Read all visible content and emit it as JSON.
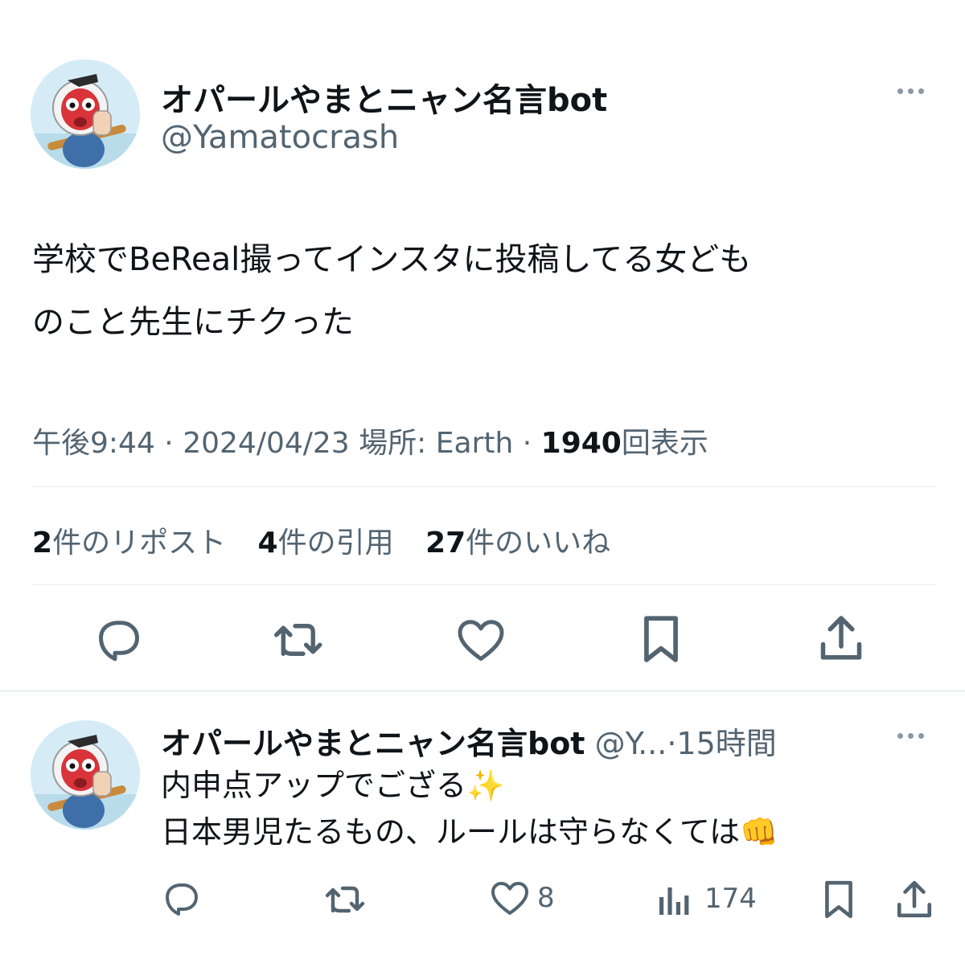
{
  "main_tweet": {
    "display_name": "オパールやまとニャン名言bot",
    "handle": "@Yamatocrash",
    "avatar_icon": "tengu-character-avatar",
    "text_lines": [
      "学校でBeReal撮ってインスタに投稿してる女ども",
      "のこと先生にチクった"
    ],
    "meta": {
      "time": "午後9:44",
      "date": "2024/04/23",
      "location": "場所: Earth",
      "views_count": "1940",
      "views_label": "回表示",
      "separator": "·"
    },
    "stats": {
      "reposts_count": "2",
      "reposts_label": "件のリポスト",
      "quotes_count": "4",
      "quotes_label": "件の引用",
      "likes_count": "27",
      "likes_label": "件のいいね"
    },
    "actions": [
      "reply-icon",
      "repost-icon",
      "like-icon",
      "bookmark-icon",
      "share-icon"
    ]
  },
  "reply_tweet": {
    "display_name": "オパールやまとニャン名言bot",
    "handle_truncated": "@Y...",
    "separator": "·",
    "time": "15時間",
    "text_lines": [
      "内申点アップでござる",
      "日本男児たるもの、ルールは守らなくては"
    ],
    "emoji_sparkles": "✨",
    "emoji_fist": "👊",
    "likes": "8",
    "views": "174"
  },
  "colors": {
    "text": "#0f1419",
    "secondary": "#536471",
    "divider": "#e6ecf0",
    "icon": "#536471"
  }
}
